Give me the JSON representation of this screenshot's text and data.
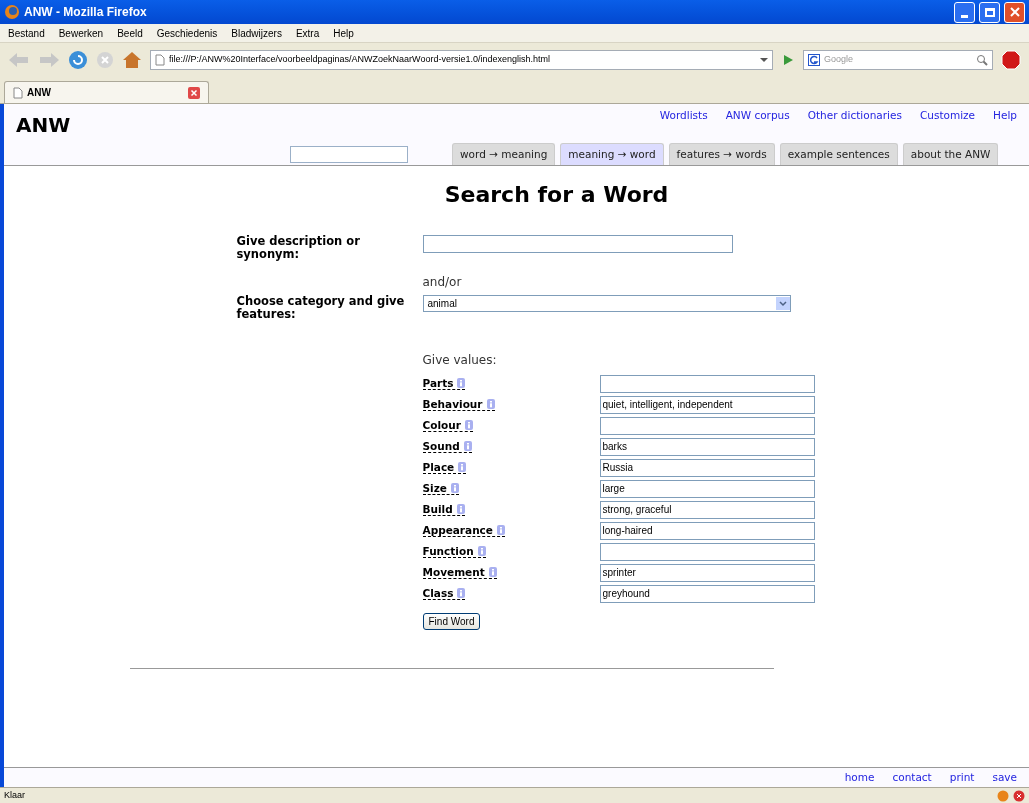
{
  "window": {
    "title": "ANW - Mozilla Firefox"
  },
  "menu": [
    "Bestand",
    "Bewerken",
    "Beeld",
    "Geschiedenis",
    "Bladwijzers",
    "Extra",
    "Help"
  ],
  "toolbar": {
    "address": "file:///P:/ANW%20Interface/voorbeeldpaginas/ANWZoekNaarWoord-versie1.0/indexenglish.html",
    "search_placeholder": "Google"
  },
  "browser_tabs": [
    {
      "label": "ANW",
      "selected": true
    }
  ],
  "page": {
    "logo": "ANW",
    "top_links": [
      "Wordlists",
      "ANW corpus",
      "Other dictionaries",
      "Customize",
      "Help"
    ],
    "tabs": [
      {
        "label": "word → meaning",
        "selected": false
      },
      {
        "label": "meaning → word",
        "selected": true
      },
      {
        "label": "features → words",
        "selected": false
      },
      {
        "label": "example sentences",
        "selected": false
      },
      {
        "label": "about the ANW",
        "selected": false
      }
    ],
    "heading": "Search for a Word",
    "description_label": "Give description or synonym:",
    "and_or": "and/or",
    "category_label": "Choose category and give features:",
    "category_value": "animal",
    "values_label": "Give values:",
    "features": [
      {
        "label": "Parts"
      },
      {
        "label": "Behaviour",
        "value": "quiet, intelligent, independent"
      },
      {
        "label": "Colour"
      },
      {
        "label": "Sound",
        "value": "barks"
      },
      {
        "label": "Place",
        "value": "Russia"
      },
      {
        "label": "Size",
        "value": "large"
      },
      {
        "label": "Build",
        "value": "strong, graceful"
      },
      {
        "label": "Appearance",
        "value": "long-haired"
      },
      {
        "label": "Function"
      },
      {
        "label": "Movement",
        "value": "sprinter"
      },
      {
        "label": "Class",
        "value": "greyhound"
      }
    ],
    "button": "Find Word",
    "footer_links": [
      "home",
      "contact",
      "print",
      "save"
    ]
  },
  "status": "Klaar"
}
